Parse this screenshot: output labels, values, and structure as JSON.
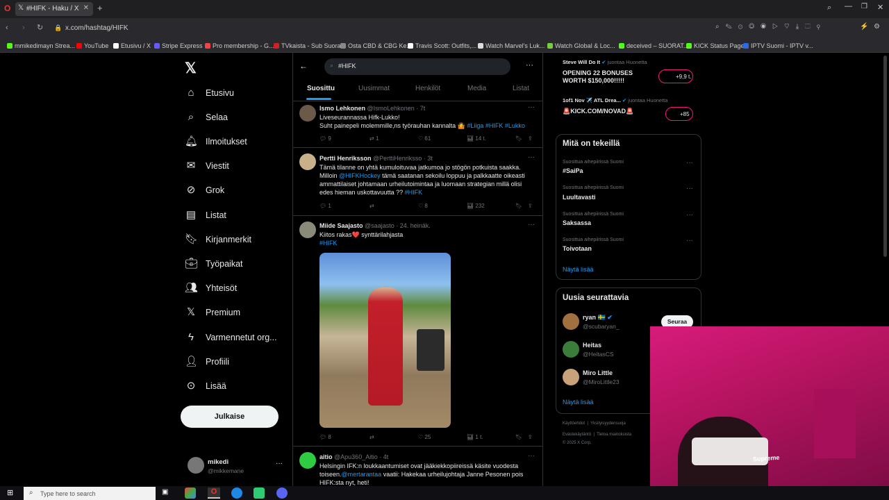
{
  "browser": {
    "tab_title": "#HIFK - Haku / X",
    "url": "x.com/hashtag/HIFK",
    "bookmarks": [
      "mmikedimayn Strea...",
      "YouTube",
      "Etusivu / X",
      "Stripe Express",
      "Pro membership - G...",
      "TVkaista - Sub Suora",
      "Osta CBD & CBG Ke...",
      "Travis Scott: Outfits,...",
      "Watch Marvel's Luk...",
      "Watch Global & Loc...",
      "deceived – SUORAT...",
      "KICK Status Page",
      "IPTV Suomi - IPTV v..."
    ]
  },
  "nav": {
    "items": [
      "Etusivu",
      "Selaa",
      "Ilmoitukset",
      "Viestit",
      "Grok",
      "Listat",
      "Kirjanmerkit",
      "Työpaikat",
      "Yhteisöt",
      "Premium",
      "Varmennetut org...",
      "Profiili",
      "Lisää"
    ],
    "post_button": "Julkaise",
    "account_name": "mikedi",
    "account_handle": "@mikkemane"
  },
  "search": {
    "value": "#HIFK"
  },
  "tabs": [
    "Suosittu",
    "Uusimmat",
    "Henkilöt",
    "Media",
    "Listat"
  ],
  "posts": [
    {
      "name": "Ismo Lehkonen",
      "handle": "@IsmoLehkonen",
      "time": "· 7t",
      "line1": "Liveseurannassa Hifk-Lukko!",
      "line2": "Suht painepeli molemmille,ns työrauhan kannalta 🤷",
      "tags": "#Liiga #HIFK #Lukko",
      "replies": "9",
      "reposts": "1",
      "likes": "61",
      "views": "14 t."
    },
    {
      "name": "Pertti Henriksson",
      "handle": "@PerttiHenriksso",
      "time": "· 3t",
      "line1": "Tämä tilanne on yhtä kumuloituvaa jatkumoa jo stögön potkuista saakka.",
      "line2a": "Milloin ",
      "mention": "@HIFKHockey",
      "line2b": " tämä saatanan sekoilu loppuu ja palkkaatte oikeasti",
      "line3": "ammattilaiset johtamaan urheilutoimintaa ja luomaan strategian millä olisi",
      "line4": "edes hieman uskottavuutta ?? ",
      "tag": "#HIFK",
      "replies": "1",
      "reposts": "",
      "likes": "8",
      "views": "232"
    },
    {
      "name": "Miide Saajasto",
      "handle": "@saajasto",
      "time": "· 24. heinäk.",
      "line1": "Kiitos rakas❤️ synttärilahjasta",
      "tag": "#HIFK",
      "replies": "8",
      "reposts": "",
      "likes": "25",
      "views": "1 t."
    },
    {
      "name": "aitio",
      "handle": "@Apu360_Aitio",
      "time": "· 4t",
      "line1": "Helsingin IFK:n loukkaantumiset ovat jääkiekkopiireissä käsite vuodesta",
      "line2a": "toiseen.",
      "mention": "@mertarantaa",
      "line2b": " vaatii: Hakekaa urheilujohtaja Janne Pesonen pois",
      "line3": "HIFK:sta nyt, heti!"
    }
  ],
  "promos": [
    {
      "name": "Steve Will Do It",
      "tag": "juontaa Huonetta",
      "text1": "OPENING 22 BONUSES",
      "text2": "WORTH $150,000!!!!!",
      "count": "+9,9 t."
    },
    {
      "name": "1of1 Nov ✈️ ATL Drea...",
      "tag": "juontaa Huonetta",
      "text1": "🚨KICK.COM/NOVAD🚨",
      "count": "+85"
    }
  ],
  "trends": {
    "title": "Mitä on tekeillä",
    "items": [
      {
        "category": "Suosittua aihepiirissä Suomi",
        "name": "#SaiPa"
      },
      {
        "category": "Suosittua aihepiirissä Suomi",
        "name": "Luultavasti"
      },
      {
        "category": "Suosittua aihepiirissä Suomi",
        "name": "Saksassa"
      },
      {
        "category": "Suosittua aihepiirissä Suomi",
        "name": "Toivotaan"
      }
    ],
    "show_more": "Näytä lisää"
  },
  "follow": {
    "title": "Uusia seurattavia",
    "items": [
      {
        "name": "ryan 🇸🇪",
        "handle": "@scubaryan_"
      },
      {
        "name": "Heitas",
        "handle": "@HeitasCS"
      },
      {
        "name": "Miro Little",
        "handle": "@MiroLittle23"
      }
    ],
    "follow_button": "Seuraa",
    "show_more": "Näytä lisää"
  },
  "footer": {
    "links": [
      "Käyttöehdot",
      "Yksityisyydensuoja",
      "Evästekäytäntö",
      "Tietoa mainoksista"
    ],
    "copyright": "© 2025 X Corp."
  },
  "taskbar": {
    "search_placeholder": "Type here to search"
  },
  "colors": {
    "accent": "#1d9bf0",
    "background": "#000000",
    "border": "#2f3336",
    "muted": "#71767b"
  }
}
